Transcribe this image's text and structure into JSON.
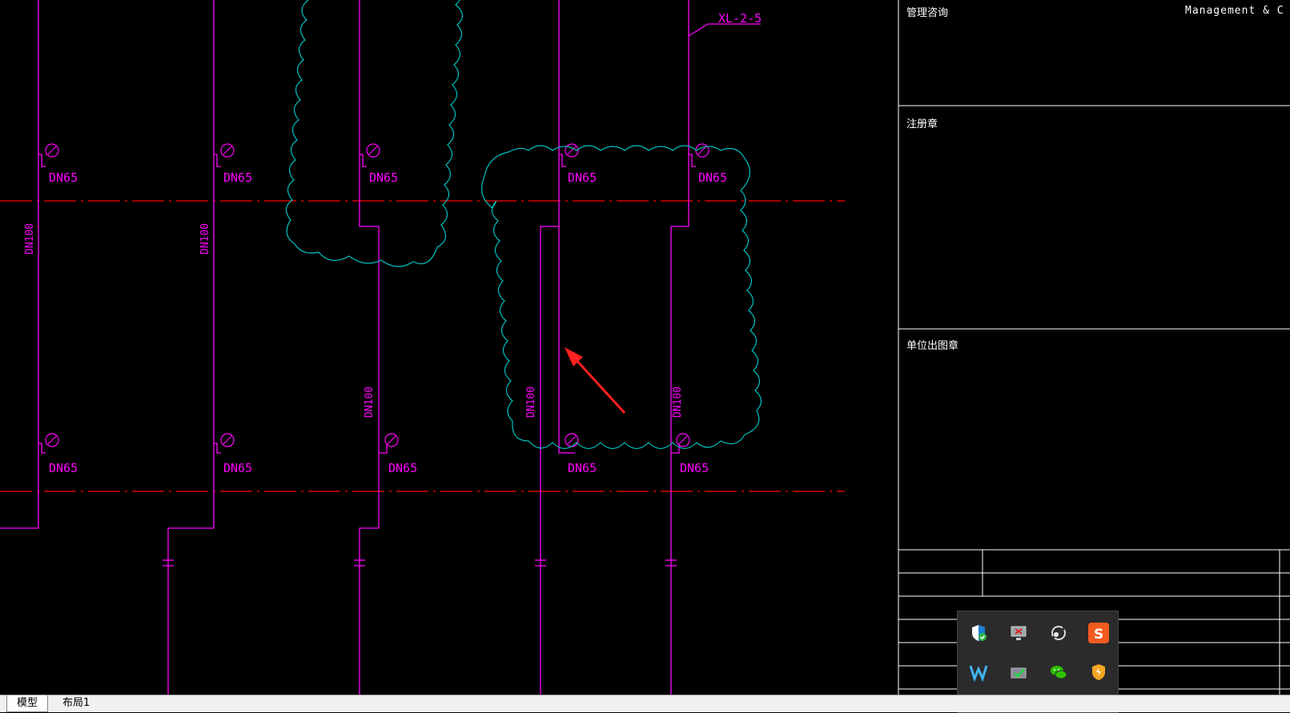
{
  "drawing": {
    "riser_label": "XL-2-5",
    "valve_labels": [
      "DN65",
      "DN65",
      "DN65",
      "DN65",
      "DN65",
      "DN65",
      "DN65",
      "DN65",
      "DN65",
      "DN65"
    ],
    "pipe_labels": [
      "DN100",
      "DN100",
      "DN100",
      "DN100",
      "DN100"
    ],
    "colors": {
      "pipe": "#ff00ff",
      "axis": "#ff0000",
      "cloud": "#00c0c0",
      "arrow": "#ff2020"
    }
  },
  "title_block": {
    "header_text": "Management & C",
    "sections": [
      "管理咨询",
      "注册章",
      "单位出图章"
    ]
  },
  "tray": {
    "icons": [
      "shield-check-icon",
      "display-error-icon",
      "network-icon",
      "sogou-icon",
      "app-w-icon",
      "display-check-icon",
      "wechat-icon",
      "security-shield-icon"
    ]
  },
  "tabs": [
    "模型",
    "布局1"
  ]
}
